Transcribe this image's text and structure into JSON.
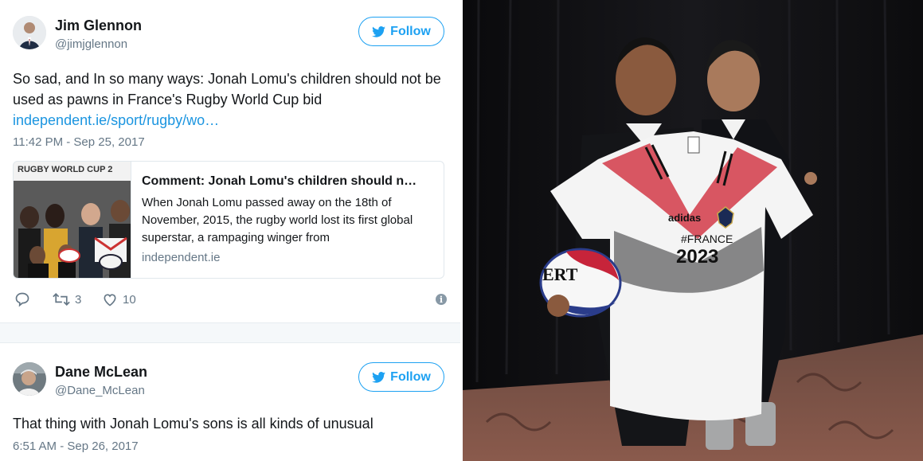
{
  "tweets": [
    {
      "name": "Jim Glennon",
      "handle": "@jimjglennon",
      "follow_label": "Follow",
      "text": "So sad, and In so many ways: Jonah Lomu's children should not be used as pawns in France's Rugby World Cup bid",
      "link": "independent.ie/sport/rugby/wo…",
      "timestamp": "11:42 PM - Sep 25, 2017",
      "card": {
        "image_caption": "RUGBY WORLD CUP 2",
        "title": "Comment: Jonah Lomu's children should n…",
        "description": "When Jonah Lomu passed away on the 18th of November, 2015, the rugby world lost its first global superstar, a rampaging winger from",
        "domain": "independent.ie"
      },
      "retweets": "3",
      "likes": "10"
    },
    {
      "name": "Dane McLean",
      "handle": "@Dane_McLean",
      "follow_label": "Follow",
      "text": "That thing with Jonah Lomu's sons is all kinds of unusual",
      "timestamp": "6:51 AM - Sep 26, 2017"
    }
  ],
  "photo": {
    "jersey_text_1": "#FRANCE",
    "jersey_text_2": "2023",
    "ball_text": "ERT",
    "brand": "adidas"
  },
  "colors": {
    "twitter_blue": "#1da1f2",
    "link_blue": "#1b95e0",
    "muted": "#657786"
  },
  "icons": [
    "twitter-bird-icon",
    "reply-icon",
    "retweet-icon",
    "heart-icon",
    "info-icon"
  ]
}
